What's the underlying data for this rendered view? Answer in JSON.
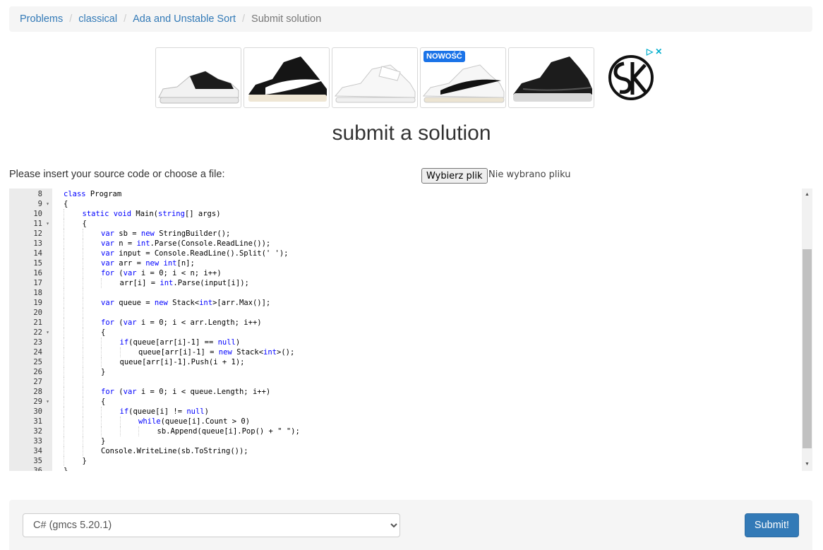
{
  "breadcrumb": {
    "items": [
      "Problems",
      "classical",
      "Ada and Unstable Sort"
    ],
    "current": "Submit solution",
    "separator": "/"
  },
  "ad": {
    "badge": "NOWOŚĆ",
    "tiles": [
      {
        "icon": "sneaker-low-white-black-icon"
      },
      {
        "icon": "sneaker-high-black-icon"
      },
      {
        "icon": "sneaker-white-strap-icon"
      },
      {
        "icon": "sneaker-white-swoosh-icon"
      },
      {
        "icon": "sneaker-basketball-black-icon"
      }
    ],
    "logo_text": "SK",
    "choices": {
      "play": "▷",
      "close": "✕"
    }
  },
  "page": {
    "title": "submit a solution",
    "prompt": "Please insert your source code or choose a file:"
  },
  "file_input": {
    "button_label": "Wybierz plik",
    "status": "Nie wybrano pliku"
  },
  "editor": {
    "lines": [
      {
        "num": "8",
        "fold": false,
        "indent": 1,
        "text": "class Program"
      },
      {
        "num": "9",
        "fold": true,
        "indent": 1,
        "text": "{"
      },
      {
        "num": "10",
        "fold": false,
        "indent": 2,
        "text": "static void Main(string[] args)"
      },
      {
        "num": "11",
        "fold": true,
        "indent": 2,
        "text": "{"
      },
      {
        "num": "12",
        "fold": false,
        "indent": 3,
        "text": "var sb = new StringBuilder();"
      },
      {
        "num": "13",
        "fold": false,
        "indent": 3,
        "text": "var n = int.Parse(Console.ReadLine());"
      },
      {
        "num": "14",
        "fold": false,
        "indent": 3,
        "text": "var input = Console.ReadLine().Split(' ');"
      },
      {
        "num": "15",
        "fold": false,
        "indent": 3,
        "text": "var arr = new int[n];"
      },
      {
        "num": "16",
        "fold": false,
        "indent": 3,
        "text": "for (var i = 0; i < n; i++)"
      },
      {
        "num": "17",
        "fold": false,
        "indent": 4,
        "text": "arr[i] = int.Parse(input[i]);"
      },
      {
        "num": "18",
        "fold": false,
        "indent": 3,
        "text": ""
      },
      {
        "num": "19",
        "fold": false,
        "indent": 3,
        "text": "var queue = new Stack<int>[arr.Max()];"
      },
      {
        "num": "20",
        "fold": false,
        "indent": 3,
        "text": ""
      },
      {
        "num": "21",
        "fold": false,
        "indent": 3,
        "text": "for (var i = 0; i < arr.Length; i++)"
      },
      {
        "num": "22",
        "fold": true,
        "indent": 3,
        "text": "{"
      },
      {
        "num": "23",
        "fold": false,
        "indent": 4,
        "text": "if(queue[arr[i]-1] == null)"
      },
      {
        "num": "24",
        "fold": false,
        "indent": 5,
        "text": "queue[arr[i]-1] = new Stack<int>();"
      },
      {
        "num": "25",
        "fold": false,
        "indent": 4,
        "text": "queue[arr[i]-1].Push(i + 1);"
      },
      {
        "num": "26",
        "fold": false,
        "indent": 3,
        "text": "}"
      },
      {
        "num": "27",
        "fold": false,
        "indent": 3,
        "text": ""
      },
      {
        "num": "28",
        "fold": false,
        "indent": 3,
        "text": "for (var i = 0; i < queue.Length; i++)"
      },
      {
        "num": "29",
        "fold": true,
        "indent": 3,
        "text": "{"
      },
      {
        "num": "30",
        "fold": false,
        "indent": 4,
        "text": "if(queue[i] != null)"
      },
      {
        "num": "31",
        "fold": false,
        "indent": 5,
        "text": "while(queue[i].Count > 0)"
      },
      {
        "num": "32",
        "fold": false,
        "indent": 6,
        "text": "sb.Append(queue[i].Pop() + \" \");"
      },
      {
        "num": "33",
        "fold": false,
        "indent": 3,
        "text": "}"
      },
      {
        "num": "34",
        "fold": false,
        "indent": 3,
        "text": "Console.WriteLine(sb.ToString());"
      },
      {
        "num": "35",
        "fold": false,
        "indent": 2,
        "text": "}"
      },
      {
        "num": "36",
        "fold": false,
        "indent": 1,
        "text": "}"
      }
    ]
  },
  "language": {
    "selected": "C# (gmcs 5.20.1)"
  },
  "submit": {
    "label": "Submit!"
  },
  "colors": {
    "link": "#337ab7",
    "keyword": "#0000ff",
    "primary_button": "#337ab7",
    "gutter": "#ebebeb",
    "panel": "#f5f5f5"
  }
}
